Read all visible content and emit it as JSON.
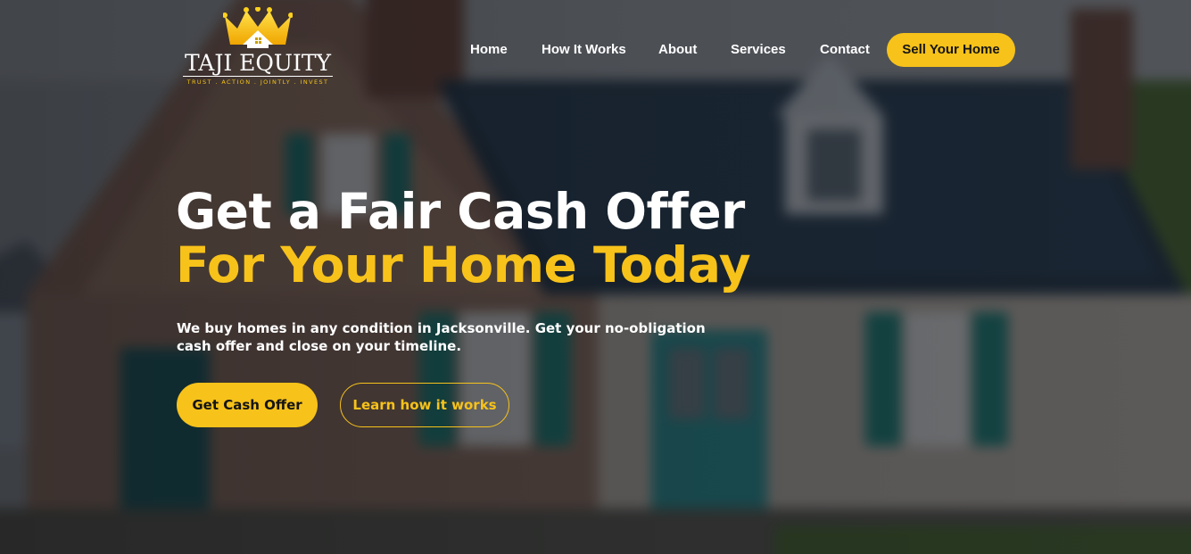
{
  "brand": {
    "name": "TAJI EQUITY",
    "tagline": "TRUST . ACTION . JOINTLY . INVEST",
    "logo_icon": "crown-house-icon"
  },
  "nav": {
    "items": [
      {
        "label": "Home"
      },
      {
        "label": "How It Works"
      },
      {
        "label": "About"
      },
      {
        "label": "Services"
      },
      {
        "label": "Contact"
      }
    ],
    "cta_label": "Sell Your Home"
  },
  "hero": {
    "headline_line1": "Get a Fair Cash Offer",
    "headline_line2": "For Your Home Today",
    "subtitle": "We buy homes in any condition in Jacksonville. Get your no-obligation cash offer and close on your timeline.",
    "primary_button": "Get Cash Offer",
    "secondary_button": "Learn how it works"
  },
  "colors": {
    "accent": "#f7c21a",
    "text": "#ffffff",
    "button_text": "#141414"
  }
}
